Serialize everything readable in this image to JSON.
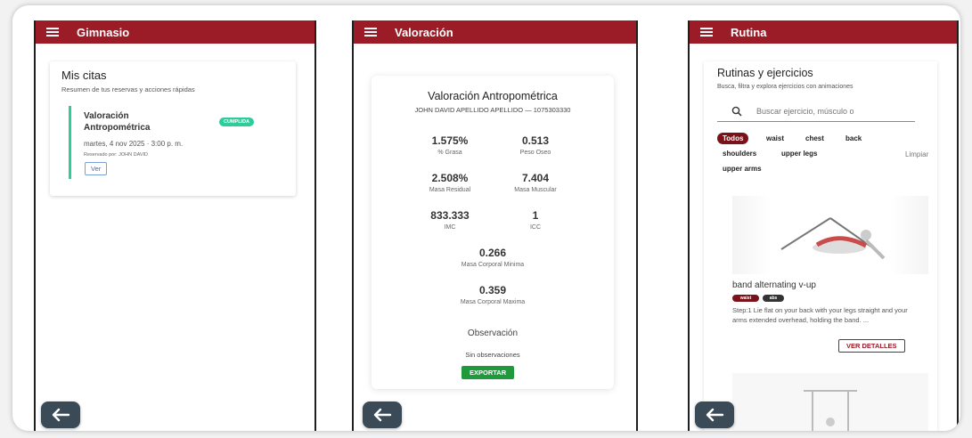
{
  "phone1": {
    "appbar_title": "Gimnasio",
    "heading": "Mis citas",
    "subtitle": "Resumen de tus reservas y acciones rápidas",
    "appointment": {
      "title": "Valoración Antropométrica",
      "status": "CUMPLIDA",
      "date": "martes, 4 nov 2025 · 3:00 p. m.",
      "reserved_by": "Reservado por: JOHN DAVID",
      "view_label": "Ver"
    }
  },
  "phone2": {
    "appbar_title": "Valoración",
    "title": "Valoración Antropométrica",
    "patient": "JOHN DAVID APELLIDO APELLIDO — 1075303330",
    "metrics": [
      {
        "value": "1.575%",
        "label": "% Grasa"
      },
      {
        "value": "0.513",
        "label": "Peso Oseo"
      },
      {
        "value": "2.508%",
        "label": "Masa Residual"
      },
      {
        "value": "7.404",
        "label": "Masa Muscular"
      },
      {
        "value": "833.333",
        "label": "IMC"
      },
      {
        "value": "1",
        "label": "ICC"
      },
      {
        "value": "0.266",
        "label": "Masa Corporal Minima"
      },
      {
        "value": "0.359",
        "label": "Masa Corporal Maxima"
      }
    ],
    "observation_heading": "Observación",
    "observation_text": "Sin observaciones",
    "export_label": "EXPORTAR"
  },
  "phone3": {
    "appbar_title": "Rutina",
    "heading": "Rutinas y ejercicios",
    "subtitle": "Busca, filtra y explora ejercicios con animaciones",
    "search_placeholder": "Buscar ejercicio, músculo o",
    "filters": [
      "Todos",
      "waist",
      "chest",
      "back",
      "shoulders",
      "upper legs",
      "upper arms"
    ],
    "clear_label": "Limpiar",
    "exercise": {
      "title": "band alternating v-up",
      "tags": [
        "waist",
        "abs"
      ],
      "description": "Step:1 Lie flat on your back with your legs straight and your arms extended overhead, holding the band. ...",
      "details_label": "VER DETALLES"
    }
  },
  "colors": {
    "appbar": "#9b1c27",
    "status_green": "#2ecc9a",
    "export_green": "#1e9a3c",
    "back_button": "#3a4a57"
  }
}
